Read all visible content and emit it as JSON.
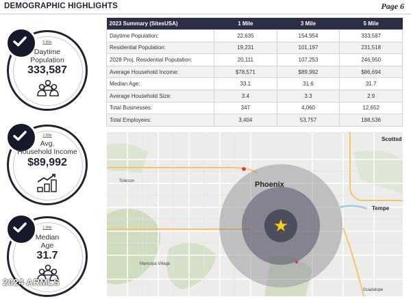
{
  "header": {
    "title": "DEMOGRAPHIC HIGHLIGHTS",
    "page": "Page 6"
  },
  "stats": [
    {
      "radius": "5 Mile",
      "label_line1": "Daytime",
      "label_line2": "Population",
      "value": "333,587",
      "icon": "people-group-icon"
    },
    {
      "radius": "3 Mile",
      "label_line1": "Avg.",
      "label_line2": "Household Income",
      "value": "$89,992",
      "icon": "money-growth-icon"
    },
    {
      "radius": "1 Mile",
      "label_line1": "Median",
      "label_line2": "Age",
      "value": "31.7",
      "icon": "people-group-icon"
    }
  ],
  "table": {
    "headers": [
      "2023 Summary (SitesUSA)",
      "1 Mile",
      "3 Mile",
      "5 Mile"
    ],
    "rows": [
      [
        "Daytime Population:",
        "22,635",
        "154,954",
        "333,587"
      ],
      [
        "Residential Population:",
        "19,231",
        "101,197",
        "231,518"
      ],
      [
        "2028 Proj. Residential Population:",
        "20,111",
        "107,253",
        "246,950"
      ],
      [
        "Average Household Income:",
        "$78,571",
        "$89,992",
        "$86,694"
      ],
      [
        "Median Age:",
        "33.1",
        "31.6",
        "31.7"
      ],
      [
        "Average Household Size:",
        "3.4",
        "3.3",
        "2.9"
      ],
      [
        "Total Businesses:",
        "347",
        "4,060",
        "12,652"
      ],
      [
        "Total Employees:",
        "3,404",
        "53,757",
        "188,536"
      ]
    ]
  },
  "map": {
    "labels": {
      "phoenix": "Phoenix",
      "tempe": "Tempe",
      "scottsdale": "Scottsd",
      "tolleson": "Tolleson",
      "maricopa_village": "Maricopa Village",
      "guadalupe": "Guadalupe"
    }
  },
  "watermark": "2024 ARMLS",
  "colors": {
    "navy": "#1f2333",
    "header_row": "#2b2f45"
  }
}
